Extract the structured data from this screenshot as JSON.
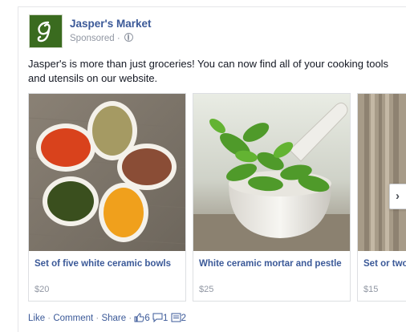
{
  "page": {
    "name": "Jasper's Market",
    "sponsored_label": "Sponsored",
    "sponsored_sep": " · ",
    "logo_letter": "g"
  },
  "post": {
    "text": "Jasper's is more than just groceries! You can now find all of your cooking tools and utensils on our website."
  },
  "carousel": {
    "items": [
      {
        "title": "Set of five white ceramic bowls",
        "price": "$20",
        "image": "spice-bowls"
      },
      {
        "title": "White ceramic mortar and pestle",
        "price": "$25",
        "image": "mortar-pestle"
      },
      {
        "title": "Set or two utensils",
        "price": "$15",
        "image": "wooden-utensils"
      }
    ],
    "next_glyph": "›"
  },
  "actions": {
    "like": "Like",
    "comment": "Comment",
    "share": "Share",
    "dot": " · ",
    "likes_count": "6",
    "comments_count": "1",
    "shares_count": "2"
  },
  "colors": {
    "link": "#3b5998",
    "meta": "#9197a3",
    "avatar_bg": "#3a6b1f"
  }
}
